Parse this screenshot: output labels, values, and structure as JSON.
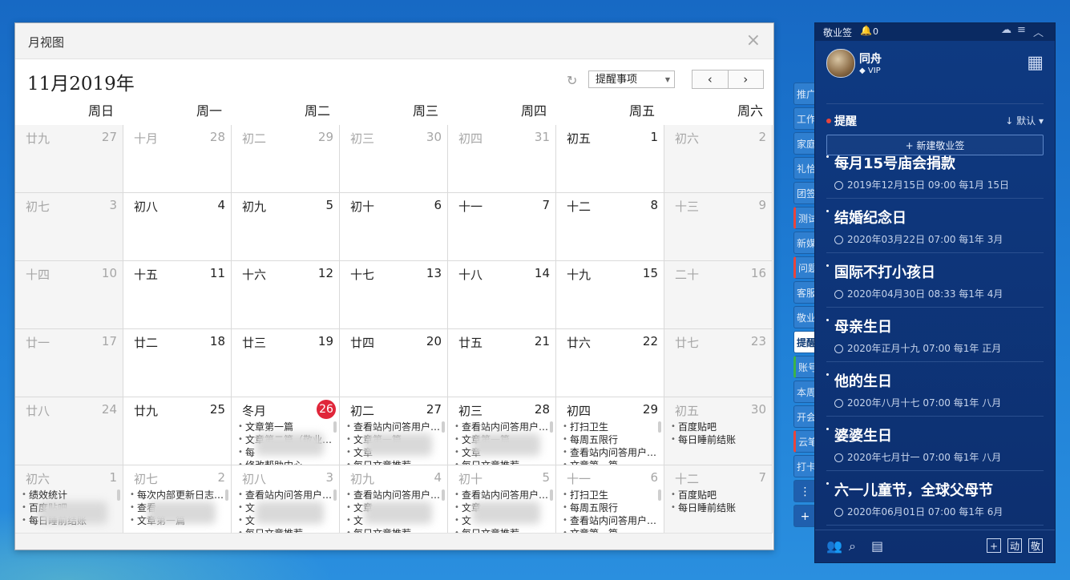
{
  "window": {
    "title": "月视图",
    "close_icon": "×"
  },
  "toolbar": {
    "month_label": "11月2019年",
    "filter_value": "提醒事项",
    "prev_icon": "‹",
    "next_icon": "›"
  },
  "weekdays": [
    "周日",
    "周一",
    "周二",
    "周三",
    "周四",
    "周五",
    "周六"
  ],
  "weeks": [
    [
      {
        "lunar": "廿九",
        "day": "27",
        "other": true
      },
      {
        "lunar": "十月",
        "day": "28",
        "other": true
      },
      {
        "lunar": "初二",
        "day": "29",
        "other": true
      },
      {
        "lunar": "初三",
        "day": "30",
        "other": true
      },
      {
        "lunar": "初四",
        "day": "31",
        "other": true
      },
      {
        "lunar": "初五",
        "day": "1"
      },
      {
        "lunar": "初六",
        "day": "2"
      }
    ],
    [
      {
        "lunar": "初七",
        "day": "3"
      },
      {
        "lunar": "初八",
        "day": "4"
      },
      {
        "lunar": "初九",
        "day": "5"
      },
      {
        "lunar": "初十",
        "day": "6"
      },
      {
        "lunar": "十一",
        "day": "7"
      },
      {
        "lunar": "十二",
        "day": "8"
      },
      {
        "lunar": "十三",
        "day": "9"
      }
    ],
    [
      {
        "lunar": "十四",
        "day": "10"
      },
      {
        "lunar": "十五",
        "day": "11"
      },
      {
        "lunar": "十六",
        "day": "12"
      },
      {
        "lunar": "十七",
        "day": "13"
      },
      {
        "lunar": "十八",
        "day": "14"
      },
      {
        "lunar": "十九",
        "day": "15"
      },
      {
        "lunar": "二十",
        "day": "16"
      }
    ],
    [
      {
        "lunar": "廿一",
        "day": "17"
      },
      {
        "lunar": "廿二",
        "day": "18"
      },
      {
        "lunar": "廿三",
        "day": "19"
      },
      {
        "lunar": "廿四",
        "day": "20"
      },
      {
        "lunar": "廿五",
        "day": "21"
      },
      {
        "lunar": "廿六",
        "day": "22"
      },
      {
        "lunar": "廿七",
        "day": "23"
      }
    ],
    [
      {
        "lunar": "廿八",
        "day": "24"
      },
      {
        "lunar": "廿九",
        "day": "25"
      },
      {
        "lunar": "冬月",
        "day": "26",
        "today": true,
        "events": [
          "文章第一篇",
          "文章第二篇（敬业…",
          "每",
          "修改帮助中心"
        ]
      },
      {
        "lunar": "初二",
        "day": "27",
        "events": [
          "查看站内问答用户…",
          "文章第一篇",
          "文章",
          "每日文章推荐"
        ]
      },
      {
        "lunar": "初三",
        "day": "28",
        "events": [
          "查看站内问答用户…",
          "文章第一篇",
          "文章",
          "每日文章推荐"
        ]
      },
      {
        "lunar": "初四",
        "day": "29",
        "events": [
          "打扫卫生",
          "每周五限行",
          "查看站内问答用户…",
          "文章第一篇"
        ]
      },
      {
        "lunar": "初五",
        "day": "30",
        "events": [
          "百度贴吧",
          "每日睡前结账"
        ]
      }
    ],
    [
      {
        "lunar": "初六",
        "day": "1",
        "other": true,
        "events": [
          "绩效统计",
          "百度贴吧",
          "每日睡前结账"
        ]
      },
      {
        "lunar": "初七",
        "day": "2",
        "other": true,
        "events": [
          "每次内部更新日志…",
          "查看",
          "文章第一篇"
        ]
      },
      {
        "lunar": "初八",
        "day": "3",
        "other": true,
        "events": [
          "查看站内问答用户…",
          "文",
          "文",
          "每日文章推荐"
        ]
      },
      {
        "lunar": "初九",
        "day": "4",
        "other": true,
        "events": [
          "查看站内问答用户…",
          "文章",
          "文",
          "每日文章推荐"
        ]
      },
      {
        "lunar": "初十",
        "day": "5",
        "other": true,
        "events": [
          "查看站内问答用户…",
          "文章",
          "文",
          "每日文章推荐"
        ]
      },
      {
        "lunar": "十一",
        "day": "6",
        "other": true,
        "events": [
          "打扫卫生",
          "每周五限行",
          "查看站内问答用户…",
          "文章第一篇"
        ]
      },
      {
        "lunar": "十二",
        "day": "7",
        "other": true,
        "events": [
          "百度贴吧",
          "每日睡前结账"
        ]
      }
    ]
  ],
  "side_tabs": [
    {
      "label": "推广"
    },
    {
      "label": "工作"
    },
    {
      "label": "家庭"
    },
    {
      "label": "礼恰"
    },
    {
      "label": "团签"
    },
    {
      "label": "测试",
      "mark": "red"
    },
    {
      "label": "新媒"
    },
    {
      "label": "问题",
      "mark": "red"
    },
    {
      "label": "客服"
    },
    {
      "label": "敬业"
    },
    {
      "label": "提醒",
      "active": true
    },
    {
      "label": "账号",
      "mark": "green"
    },
    {
      "label": "本周"
    },
    {
      "label": "开会"
    },
    {
      "label": "云笔",
      "mark": "red"
    },
    {
      "label": "打卡"
    }
  ],
  "side_more_icon": "⋮",
  "side_add_icon": "+",
  "panel": {
    "app_name": "敬业签",
    "notification_count": "0",
    "user": {
      "name": "同舟",
      "badge": "VIP"
    },
    "section_title": "提醒",
    "sort_label": "默认",
    "sort_icon": "↓",
    "new_button": "+ 新建敬业签",
    "reminders": [
      {
        "title": "每月15号庙会捐款",
        "meta": "2019年12月15日 09:00 每1月 15日"
      },
      {
        "title": "结婚纪念日",
        "meta": "2020年03月22日 07:00 每1年 3月"
      },
      {
        "title": "国际不打小孩日",
        "meta": "2020年04月30日 08:33 每1年 4月"
      },
      {
        "title": "母亲生日",
        "meta": "2020年正月十九 07:00 每1年 正月"
      },
      {
        "title": "他的生日",
        "meta": "2020年八月十七 07:00 每1年 八月"
      },
      {
        "title": "婆婆生日",
        "meta": "2020年七月廿一 07:00 每1年 八月"
      },
      {
        "title": "六一儿童节，全球父母节",
        "meta": "2020年06月01日 07:00 每1年 6月"
      }
    ],
    "footer_buttons": [
      "+",
      "动",
      "敬"
    ]
  }
}
